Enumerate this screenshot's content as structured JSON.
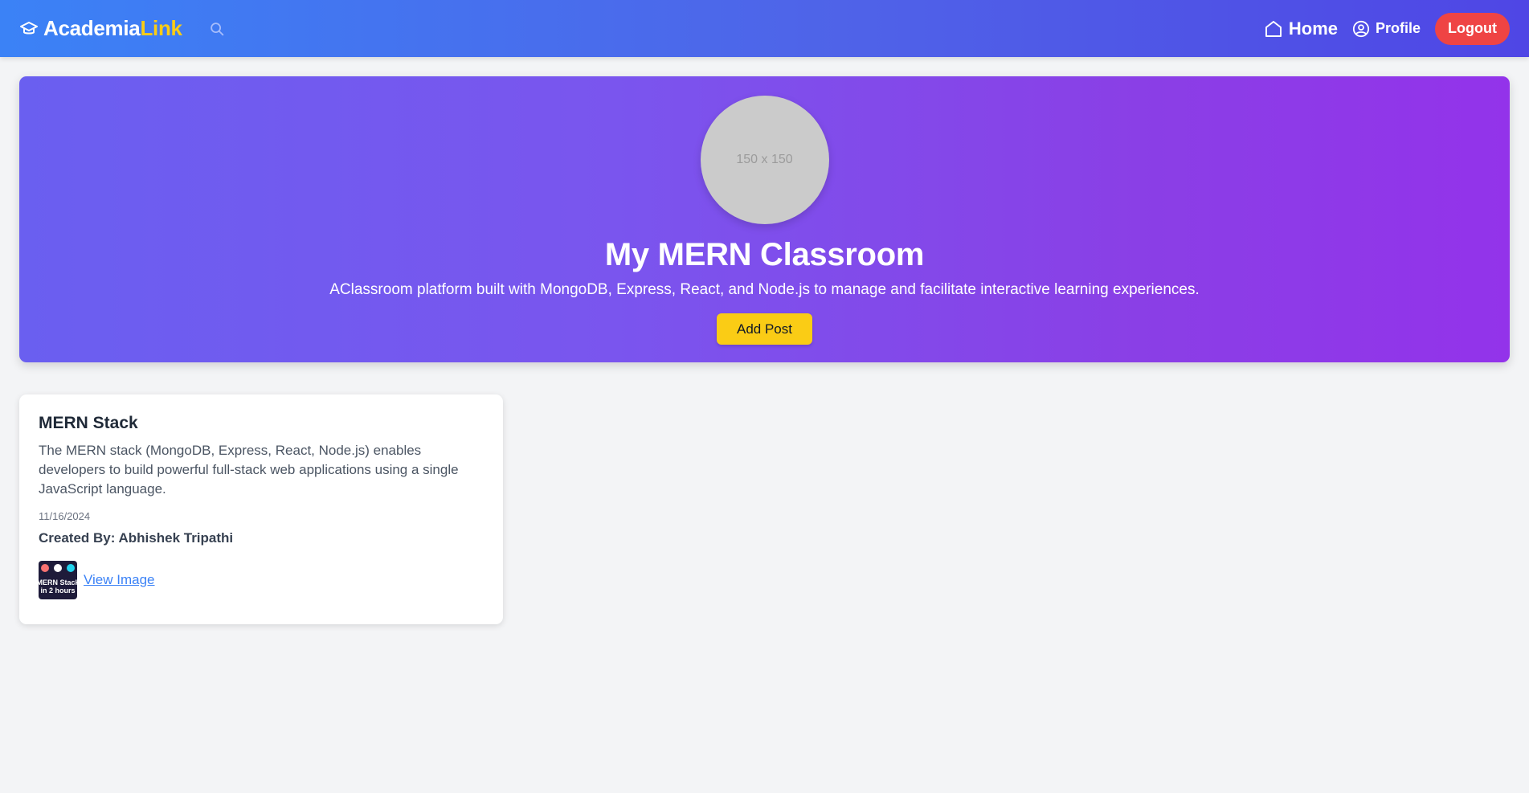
{
  "navbar": {
    "brand_name": "Academia",
    "brand_accent": "Link",
    "brand_icon": "graduation-cap-icon",
    "search_icon": "search-icon",
    "home_label": "Home",
    "profile_label": "Profile",
    "logout_label": "Logout"
  },
  "hero": {
    "avatar_placeholder": "150 x 150",
    "title": "My MERN Classroom",
    "description": "AClassroom platform built with MongoDB, Express, React, and Node.js to manage and facilitate interactive learning experiences.",
    "add_post_label": "Add Post"
  },
  "posts": [
    {
      "title": "MERN Stack",
      "description": "The MERN stack (MongoDB, Express, React, Node.js) enables developers to build powerful full-stack web applications using a single JavaScript language.",
      "date": "11/16/2024",
      "author": "Created By: Abhishek Tripathi",
      "thumbnail_text_1": "MERN Stack",
      "thumbnail_text_2": "in 2 hours",
      "view_image_label": "View Image"
    }
  ],
  "colors": {
    "navbar_start": "#3b82f6",
    "navbar_end": "#4f46e5",
    "hero_start": "#6a5ff0",
    "hero_end": "#9333ea",
    "accent_yellow": "#facc15",
    "logout_red": "#ef4444",
    "link_blue": "#3b82f6"
  }
}
